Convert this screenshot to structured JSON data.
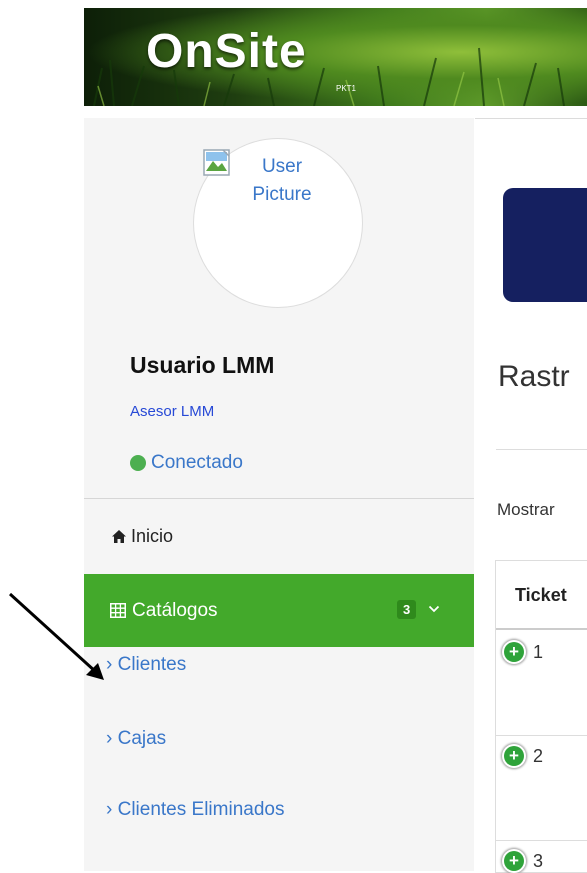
{
  "header": {
    "logo_text": "OnSite",
    "logo_subtext": "PKT1"
  },
  "sidebar": {
    "avatar_alt": "User Picture",
    "user_name": "Usuario LMM",
    "user_role": "Asesor LMM",
    "status_text": "Conectado",
    "status_color": "#4caf50",
    "nav": {
      "inicio_label": "Inicio",
      "catalogos_label": "Catálogos",
      "catalogos_badge": "3",
      "accent": "#43a92b"
    },
    "sub_items": [
      {
        "label": "Clientes"
      },
      {
        "label": "Cajas"
      },
      {
        "label": "Clientes Eliminados"
      }
    ]
  },
  "main": {
    "heading_fragment": "Rastr",
    "mostrar_label": "Mostrar",
    "table": {
      "header": "Ticket",
      "rows": [
        "1",
        "2",
        "3"
      ]
    }
  }
}
